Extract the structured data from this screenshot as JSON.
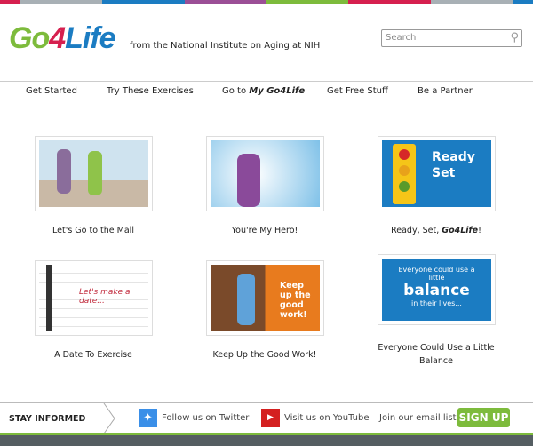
{
  "colors": {
    "bar": [
      "#d6204f",
      "#a8b0b5",
      "#1b7cc2",
      "#9b4f96",
      "#7dbb3c",
      "#d6204f",
      "#a8b0b5",
      "#1b7cc2"
    ],
    "green": "#7dbb3c"
  },
  "header": {
    "logo": {
      "go": "Go",
      "four": "4",
      "life": "Life"
    },
    "tagline": "from the National Institute on Aging at NIH",
    "search_placeholder": "Search"
  },
  "nav": [
    {
      "label": "Get Started"
    },
    {
      "label": "Try These Exercises"
    },
    {
      "prefix": "Go to ",
      "label": "My Go4Life"
    },
    {
      "label": "Get Free Stuff"
    },
    {
      "label": "Be a Partner"
    }
  ],
  "cards": [
    {
      "title": "Let's Go to the Mall"
    },
    {
      "title": "You're My Hero!"
    },
    {
      "title": "Ready, Set, ",
      "title_em": "Go4Life",
      "title_end": "!",
      "img_text": [
        "Ready",
        "Set"
      ]
    },
    {
      "title": "A Date To Exercise",
      "img_text": "Let's make a date..."
    },
    {
      "title": "Keep Up the Good Work!",
      "img_text": "Keep up the good work!"
    },
    {
      "title": "Everyone Could Use a Little Balance",
      "img_text": [
        "Everyone could use a little",
        "balance",
        "in their lives..."
      ]
    }
  ],
  "footer": {
    "stay": "STAY INFORMED",
    "twitter": "Follow us on Twitter",
    "youtube": "Visit us on YouTube",
    "email": "Join our email list!",
    "signup": "SIGN UP"
  }
}
